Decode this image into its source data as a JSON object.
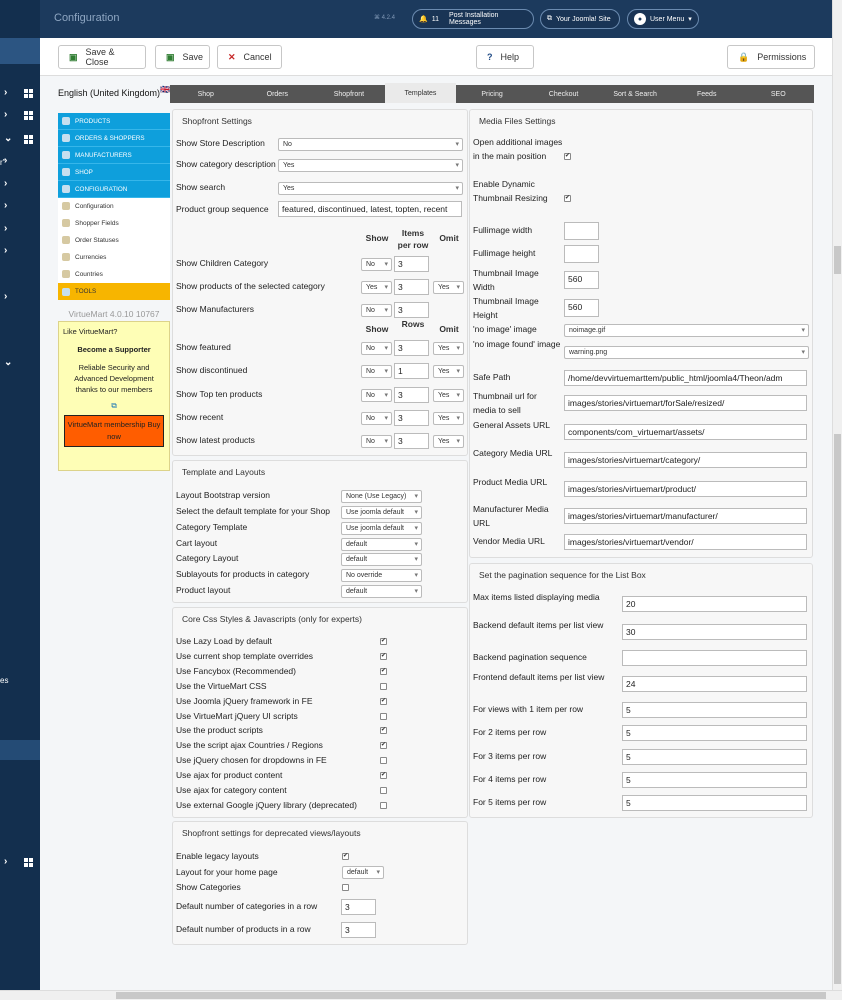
{
  "header": {
    "title": "Configuration",
    "version": "4.2.4",
    "notif_count": "11",
    "notif_label": "Post Installation Messages",
    "site_label": "Your Joomla! Site",
    "user_label": "User Menu"
  },
  "sidebar_cut": {
    "a": "r\"",
    "b": "es"
  },
  "toolbar": {
    "save_close": "Save & Close",
    "save": "Save",
    "cancel": "Cancel",
    "help": "Help",
    "permissions": "Permissions"
  },
  "lang": "English (United Kingdom)",
  "menu": [
    "PRODUCTS",
    "ORDERS & SHOPPERS",
    "MANUFACTURERS",
    "SHOP",
    "CONFIGURATION",
    "Configuration",
    "Shopper Fields",
    "Order Statuses",
    "Currencies",
    "Countries",
    "TOOLS"
  ],
  "vm_version": "VirtueMart 4.0.10 10767",
  "support": {
    "q": "Like VirtueMart?",
    "title": "Become a Supporter",
    "text": "Reliable Security and Advanced Development thanks to our members",
    "btn": "VirtueMart membership Buy now"
  },
  "tabs": [
    "Shop",
    "Orders",
    "Shopfront",
    "Templates",
    "Pricing",
    "Checkout",
    "Sort & Search",
    "Feeds",
    "SEO"
  ],
  "shopfront": {
    "legend": "Shopfront Settings",
    "rows": [
      {
        "label": "Show Store Description",
        "value": "No"
      },
      {
        "label": "Show category description",
        "value": "Yes"
      },
      {
        "label": "Show search",
        "value": "Yes"
      },
      {
        "label": "Product group sequence",
        "value": "featured, discontinued, latest, topten, recent"
      }
    ],
    "h1": {
      "show": "Show",
      "items": "Items per row",
      "omit": "Omit"
    },
    "grp1": [
      {
        "label": "Show Children Category",
        "show": "No",
        "n": "3",
        "omit": ""
      },
      {
        "label": "Show products of the selected category",
        "show": "Yes",
        "n": "3",
        "omit": "Yes"
      },
      {
        "label": "Show Manufacturers",
        "show": "No",
        "n": "3",
        "omit": ""
      }
    ],
    "h2": {
      "show": "Show",
      "rows": "Rows",
      "omit": "Omit"
    },
    "grp2": [
      {
        "label": "Show featured",
        "show": "No",
        "n": "3",
        "omit": "Yes"
      },
      {
        "label": "Show discontinued",
        "show": "No",
        "n": "1",
        "omit": "Yes"
      },
      {
        "label": "Show Top ten products",
        "show": "No",
        "n": "3",
        "omit": "Yes"
      },
      {
        "label": "Show recent",
        "show": "No",
        "n": "3",
        "omit": "Yes"
      },
      {
        "label": "Show latest products",
        "show": "No",
        "n": "3",
        "omit": "Yes"
      }
    ]
  },
  "tpl": {
    "legend": "Template and Layouts",
    "rows": [
      {
        "label": "Layout Bootstrap version",
        "value": "None (Use Legacy)"
      },
      {
        "label": "Select the default template for your Shop",
        "value": "Use joomla default"
      },
      {
        "label": "Category Template",
        "value": "Use joomla default"
      },
      {
        "label": "Cart layout",
        "value": "default"
      },
      {
        "label": "Category Layout",
        "value": "default"
      },
      {
        "label": "Sublayouts for products in category",
        "value": "No override"
      },
      {
        "label": "Product layout",
        "value": "default"
      }
    ]
  },
  "css": {
    "legend": "Core Css Styles & Javascripts (only for experts)",
    "rows": [
      {
        "label": "Use Lazy Load by default",
        "on": true
      },
      {
        "label": "Use current shop template overrides",
        "on": true
      },
      {
        "label": "Use Fancybox (Recommended)",
        "on": true
      },
      {
        "label": "Use the VirtueMart CSS",
        "on": false
      },
      {
        "label": "Use Joomla jQuery framework in FE",
        "on": true
      },
      {
        "label": "Use VirtueMart jQuery UI scripts",
        "on": false
      },
      {
        "label": "Use the product scripts",
        "on": true
      },
      {
        "label": "Use the script ajax Countries / Regions",
        "on": true
      },
      {
        "label": "Use jQuery chosen for dropdowns in FE",
        "on": false
      },
      {
        "label": "Use ajax for product content",
        "on": true
      },
      {
        "label": "Use ajax for category content",
        "on": false
      },
      {
        "label": "Use external Google jQuery library (deprecated)",
        "on": false
      }
    ]
  },
  "legacy": {
    "legend": "Shopfront settings for deprecated views/layouts",
    "enable": "Enable legacy layouts",
    "home": "Layout for your home page",
    "home_val": "default",
    "cats": "Show Categories",
    "ncat": "Default number of categories in a row",
    "ncat_val": "3",
    "nprod": "Default number of products in a row",
    "nprod_val": "3"
  },
  "media": {
    "legend": "Media Files Settings",
    "open": "Open additional images in the main position",
    "dyn": "Enable Dynamic Thumbnail Resizing",
    "fw": "Fullimage width",
    "fw_val": "",
    "fh": "Fullimage height",
    "fh_val": "",
    "tw": "Thumbnail Image Width",
    "tw_val": "560",
    "th": "Thumbnail Image Height",
    "th_val": "560",
    "noimg": "'no image' image",
    "noimg_val": "noimage.gif",
    "nofound": "'no image found' image",
    "nofound_val": "warning.png",
    "paths": [
      {
        "label": "Safe Path",
        "value": "/home/devvirtuemarttem/public_html/joomla4/Theon/adm"
      },
      {
        "label": "Thumbnail url for media to sell",
        "value": "images/stories/virtuemart/forSale/resized/"
      },
      {
        "label": "General Assets URL",
        "value": "components/com_virtuemart/assets/"
      },
      {
        "label": "Category Media URL",
        "value": "images/stories/virtuemart/category/"
      },
      {
        "label": "Product Media URL",
        "value": "images/stories/virtuemart/product/"
      },
      {
        "label": "Manufacturer Media URL",
        "value": "images/stories/virtuemart/manufacturer/"
      },
      {
        "label": "Vendor Media URL",
        "value": "images/stories/virtuemart/vendor/"
      }
    ]
  },
  "pag": {
    "legend": "Set the pagination sequence for the List Box",
    "rows": [
      {
        "label": "Max items listed displaying media",
        "value": "20"
      },
      {
        "label": "Backend default items per list view",
        "value": "30"
      },
      {
        "label": "Backend pagination sequence",
        "value": ""
      },
      {
        "label": "Frontend default items per list view",
        "value": "24"
      },
      {
        "label": "For views with 1 item per row",
        "value": "5"
      },
      {
        "label": "For 2 items per row",
        "value": "5"
      },
      {
        "label": "For 3 items per row",
        "value": "5"
      },
      {
        "label": "For 4 items per row",
        "value": "5"
      },
      {
        "label": "For 5 items per row",
        "value": "5"
      }
    ]
  }
}
